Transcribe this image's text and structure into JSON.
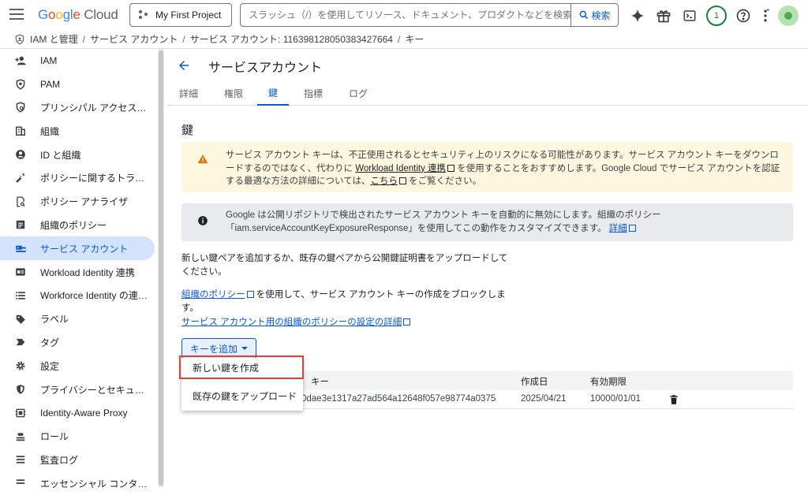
{
  "header": {
    "logo_google": [
      "G",
      "o",
      "o",
      "g",
      "l",
      "e"
    ],
    "logo_cloud": "Cloud",
    "project": "My First Project",
    "search_placeholder": "スラッシュ（/）を使用してリソース、ドキュメント、プロダクトなどを検索",
    "search_button": "検索",
    "notification_count": "1"
  },
  "breadcrumb": [
    "IAM と管理",
    "サービス アカウント",
    "サービス アカウント: 116398128050383427664",
    "キー"
  ],
  "sidebar": {
    "items": [
      {
        "label": "IAM",
        "icon": "person-add-icon"
      },
      {
        "label": "PAM",
        "icon": "shield-icon"
      },
      {
        "label": "プリンシパル アクセス…",
        "icon": "policy-shield-icon"
      },
      {
        "label": "組織",
        "icon": "building-icon"
      },
      {
        "label": "ID と組織",
        "icon": "account-circle-icon"
      },
      {
        "label": "ポリシーに関するトラ…",
        "icon": "wrench-icon"
      },
      {
        "label": "ポリシー アナライザ",
        "icon": "document-search-icon"
      },
      {
        "label": "組織のポリシー",
        "icon": "list-icon"
      },
      {
        "label": "サービス アカウント",
        "icon": "service-account-icon",
        "active": true
      },
      {
        "label": "Workload Identity 連携",
        "icon": "badge-icon"
      },
      {
        "label": "Workforce Identity の連…",
        "icon": "list-bullets-icon"
      },
      {
        "label": "ラベル",
        "icon": "label-icon"
      },
      {
        "label": "タグ",
        "icon": "tag-icon"
      },
      {
        "label": "設定",
        "icon": "gear-icon"
      },
      {
        "label": "プライバシーとセキュ…",
        "icon": "security-shield-icon"
      },
      {
        "label": "Identity-Aware Proxy",
        "icon": "proxy-icon"
      },
      {
        "label": "ロール",
        "icon": "roles-icon"
      },
      {
        "label": "監査ログ",
        "icon": "audit-log-icon"
      },
      {
        "label": "エッセンシャル コンタ…",
        "icon": "contacts-icon"
      }
    ]
  },
  "page": {
    "title": "サービスアカウント",
    "tabs": [
      "詳細",
      "権限",
      "鍵",
      "指標",
      "ログ"
    ],
    "active_tab": "鍵",
    "section_title": "鍵",
    "warning": {
      "text1": "サービス アカウント キーは、不正使用されるとセキュリティ上のリスクになる可能性があります。サービス アカウント キーをダウンロードするのではなく、代わりに ",
      "link1": "Workload Identity 連携",
      "text2": " を使用することをおすすめします。Google Cloud でサービス アカウントを認証する最適な方法の詳細については、",
      "link2": "こちら",
      "text3": " をご覧ください。"
    },
    "info": {
      "text1": "Google は公開リポジトリで検出されたサービス アカウント キーを自動的に無効にします。組織のポリシー「iam.serviceAccountKeyExposureResponse」を使用してこの動作をカスタマイズできます。",
      "link": "詳細"
    },
    "para1": "新しい鍵ペアを追加するか、既存の鍵ペアから公開鍵証明書をアップロードしてください。",
    "para2_link": "組織のポリシー",
    "para2_text": " を使用して、サービス アカウント キーの作成をブロックします。",
    "para3_link": "サービス アカウント用の組織のポリシーの設定の詳細",
    "add_key_button": "キーを追加",
    "table": {
      "headers": [
        "キー",
        "作成日",
        "有効期限"
      ],
      "rows": [
        {
          "key": "0dae3e1317a27ad564a12648f057e98774a0375",
          "created": "2025/04/21",
          "expires": "10000/01/01"
        }
      ]
    },
    "menu": {
      "items": [
        "新しい鍵を作成",
        "既存の鍵をアップロード"
      ],
      "highlighted": "新しい鍵を作成"
    }
  },
  "colors": {
    "accent": "#0b57d0",
    "active_nav_bg": "#d3e3fd",
    "warning_bg": "#fef7e0",
    "warning_icon": "#e37400",
    "highlight_border": "#db4437"
  }
}
